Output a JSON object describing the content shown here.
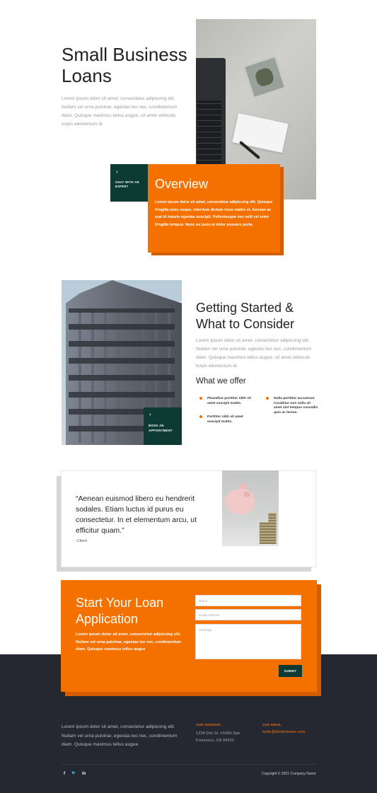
{
  "hero": {
    "title": "Small Business Loans",
    "body": "Lorem ipsum dolor sit amet, consectetur adipiscing elit. Nullam vel urna pulvinar, egestas leo nec, condimentum diam. Quisque maximus tellus augue, sit amet vehicula turpis elementum id.",
    "chat_label": "CHAT WITH AN EXPERT"
  },
  "overview": {
    "title": "Overview",
    "body": "Lorem ipsum dolor sit amet, consectetur adipiscing elit. Quisque fringilla nunc neque, interdum dictum risus mattis et. Aenean ac erat id mauris egestas suscipit. Pellentesque nec velit vel enim fringilla tempus. Nunc eu justo et dolor posuere porta."
  },
  "getting_started": {
    "title": "Getting Started & What to Consider",
    "body": "Lorem ipsum dolor sit amet, consectetur adipiscing elit. Nullam vel urna pulvinar, egestas leo nec, condimentum diam. Quisque maximus tellus augue, sit amet vehicula turpis elementum id.",
    "book_label": "BOOK AN APPOINTMENT",
    "offer_title": "What we offer",
    "offers": [
      "Phasellus porttitor nibh sit amet suscipit mattis.",
      "Nulla porttitor accumsan Curabitur non nulla sit amet nisl tempus convallis quis ac lectus.",
      "Porttitor nibh sit amet suscipit mattis."
    ]
  },
  "testimonial": {
    "quote": "“Aenean euismod libero eu hendrerit sodales. Etiam luctus id purus eu consectetur. In et elementum arcu, ut efficitur quam.”",
    "author": "-Client"
  },
  "application": {
    "title": "Start Your Loan Application",
    "body": "Lorem ipsum dolor sit amet, consectetur adipiscing elit. Nullam vel urna pulvinar, egestas leo nec, condimentum diam. Quisque maximus tellus augue",
    "name_placeholder": "Name",
    "email_placeholder": "Email Address",
    "message_placeholder": "Message",
    "submit_label": "SUBMIT"
  },
  "footer": {
    "body": "Lorem ipsum dolor sit amet, consectetur adipiscing elit. Nullam vel urna pulvinar, egestas leo nec, condimentum diam. Quisque maximus tellus augue",
    "address_heading": "OUR ADDRESS",
    "address_line1": "1234 Divi St. #1000 San",
    "address_line2": "Francisco, CA 94220",
    "email_heading": "OUR EMAIL",
    "email": "hello@diviardware.com",
    "social": {
      "facebook": "f",
      "twitter": "🐦",
      "linkedin": "in"
    },
    "copyright": "Copyright © 2021 Company Name"
  },
  "icons": {
    "chevron": "chevron-right-icon"
  },
  "colors": {
    "accent": "#f47100",
    "dark_green": "#0d3b33",
    "footer_bg": "#252830"
  }
}
